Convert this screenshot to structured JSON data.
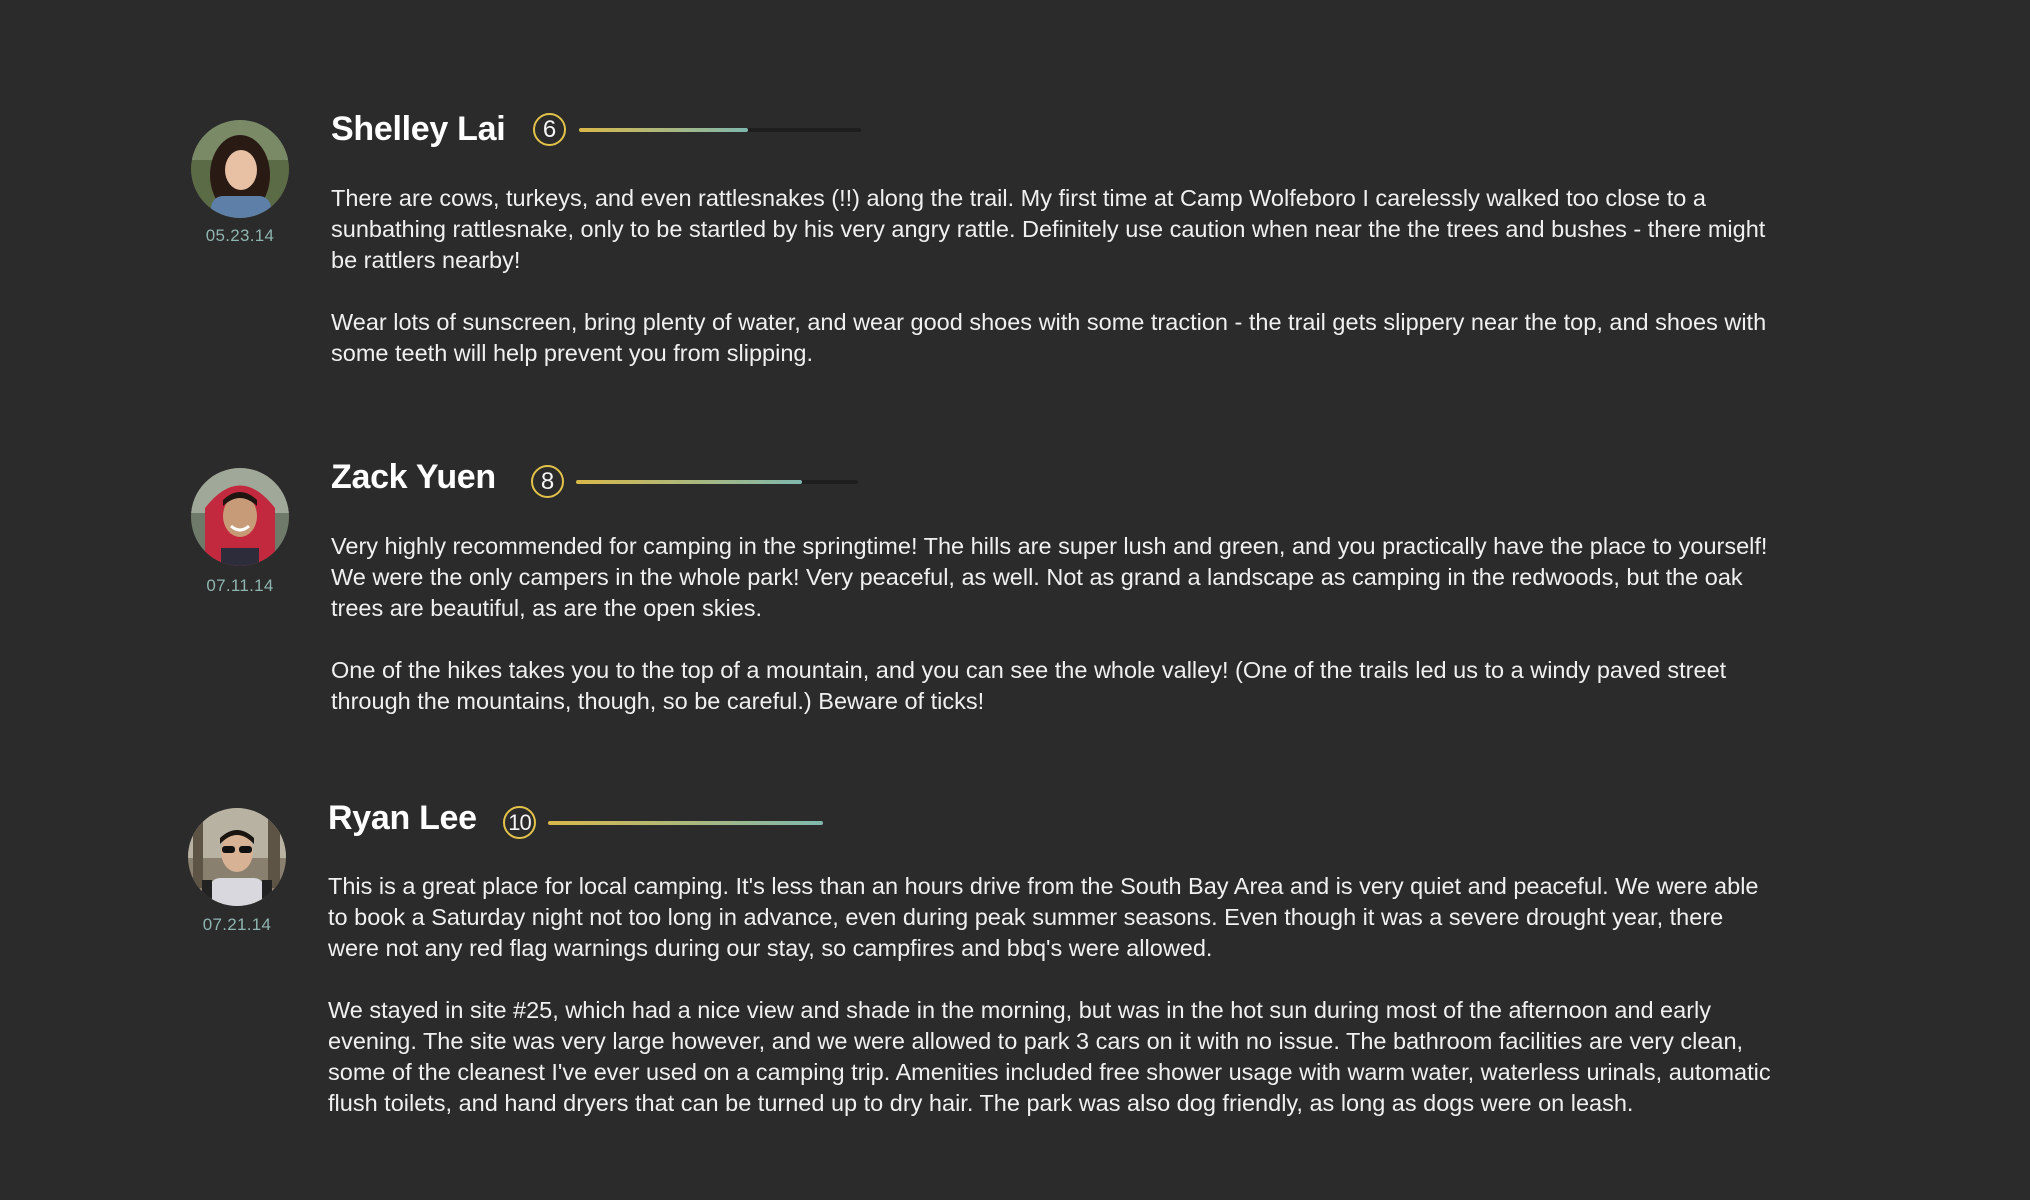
{
  "colors": {
    "background": "#2b2b2b",
    "date_text": "#8fb5b0",
    "badge_ring": "#e3c24a",
    "bar_gradient_start": "#d9b84a",
    "bar_gradient_end": "#7fb8ae",
    "bar_track": "#1e1e1e"
  },
  "reviews": [
    {
      "name": "Shelley Lai",
      "score": "6",
      "score_fraction": 0.6,
      "date": "05.23.14",
      "avatar_icon": "user-photo-shelley",
      "paragraphs": [
        "There are cows, turkeys, and even rattlesnakes (!!) along the trail. My first time at Camp Wolfeboro I carelessly walked too close to a\nsunbathing rattlesnake, only to be startled by his very angry rattle. Definitely use caution when near the the trees and bushes - there might\nbe rattlers nearby!",
        "Wear lots of sunscreen, bring plenty of water, and wear good shoes with some traction - the trail gets slippery near the top, and shoes with\nsome teeth will help prevent you from slipping."
      ]
    },
    {
      "name": "Zack Yuen",
      "score": "8",
      "score_fraction": 0.8,
      "date": "07.11.14",
      "avatar_icon": "user-photo-zack",
      "paragraphs": [
        "Very highly recommended for camping in the springtime! The hills are super lush and green, and you practically have the place to yourself!\nWe were the only campers in the whole park! Very peaceful, as well. Not as grand a landscape as camping in the redwoods, but the oak\ntrees are beautiful, as are the open skies.",
        "One of the hikes takes you to the top of a mountain, and you can see the whole valley! (One of the trails led us to a windy paved street\nthrough the mountains, though, so be careful.) Beware of ticks!"
      ]
    },
    {
      "name": "Ryan Lee",
      "score": "10",
      "score_fraction": 1.0,
      "date": "07.21.14",
      "avatar_icon": "user-photo-ryan",
      "paragraphs": [
        "This is a great place for local camping. It's less than an hours drive from the South Bay Area and is very quiet and peaceful. We were able\nto book a Saturday night not too long in advance, even during peak summer seasons. Even though it was a severe drought year, there\nwere not any red flag warnings during our stay, so campfires and bbq's were allowed.",
        "We stayed in site #25, which had a nice view and shade in the morning, but was in the hot sun during most of the afternoon and early\nevening. The site was very large however, and we were allowed to park 3 cars on it with no issue. The bathroom facilities are very clean,\nsome of the cleanest I've ever used on a camping trip. Amenities included free shower usage with warm water, waterless urinals, automatic\nflush toilets, and hand dryers that can be turned up to dry hair. The park was also dog friendly, as long as dogs were on leash."
      ]
    }
  ]
}
